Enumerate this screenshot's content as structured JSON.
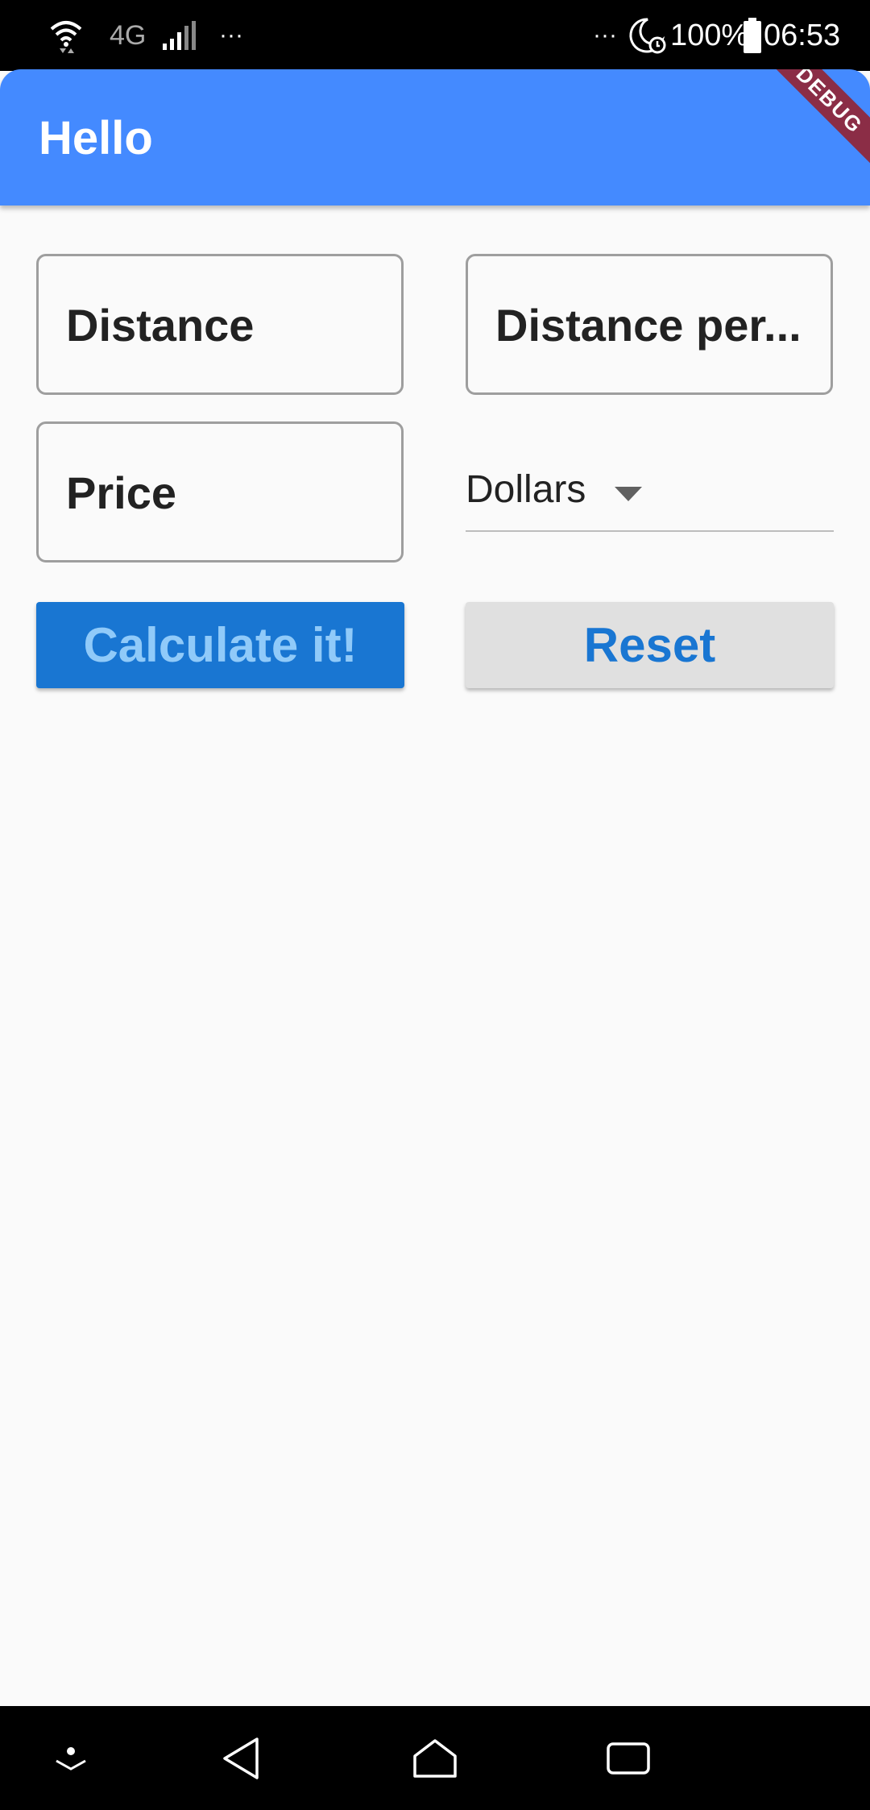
{
  "status_bar": {
    "network": "4G",
    "more_left": "···",
    "more_right": "···",
    "battery": "100%",
    "time": "06:53"
  },
  "app_bar": {
    "title": "Hello",
    "debug_banner": "DEBUG",
    "color": "#448aff"
  },
  "form": {
    "distance_label": "Distance",
    "distance_per_label": "Distance per...",
    "price_label": "Price",
    "currency": {
      "selected": "Dollars"
    }
  },
  "buttons": {
    "calculate": "Calculate it!",
    "reset": "Reset"
  },
  "colors": {
    "primary": "#1976d2",
    "secondary_bg": "#e0e0e0"
  },
  "nav_bar": {
    "icons": [
      "collapse-icon",
      "back-icon",
      "home-icon",
      "recents-icon"
    ]
  }
}
